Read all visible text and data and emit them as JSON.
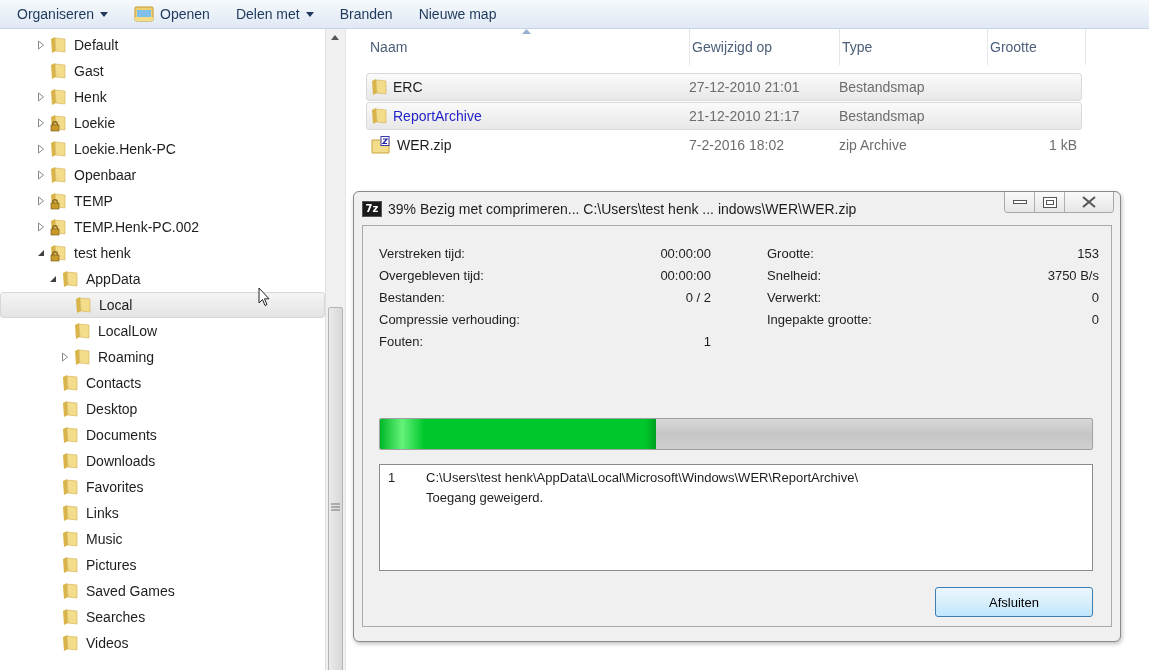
{
  "toolbar": {
    "items": [
      {
        "label": "Organiseren",
        "kind": "menu"
      },
      {
        "label": "Openen",
        "kind": "open"
      },
      {
        "label": "Delen met",
        "kind": "menu"
      },
      {
        "label": "Branden",
        "kind": "plain"
      },
      {
        "label": "Nieuwe map",
        "kind": "plain"
      }
    ]
  },
  "tree": {
    "items": [
      {
        "label": "Default",
        "expanded": false,
        "locked": false,
        "selected": false
      },
      {
        "label": "Gast",
        "locked": false,
        "selected": false
      },
      {
        "label": "Henk",
        "expanded": false,
        "locked": false,
        "selected": false
      },
      {
        "label": "Loekie",
        "expanded": false,
        "locked": true,
        "selected": false
      },
      {
        "label": "Loekie.Henk-PC",
        "expanded": false,
        "locked": false,
        "selected": false
      },
      {
        "label": "Openbaar",
        "expanded": false,
        "locked": false,
        "selected": false
      },
      {
        "label": "TEMP",
        "expanded": false,
        "locked": true,
        "selected": false
      },
      {
        "label": "TEMP.Henk-PC.002",
        "expanded": false,
        "locked": true,
        "selected": false
      },
      {
        "label": "test henk",
        "expanded": true,
        "locked": true,
        "selected": false,
        "children": [
          {
            "label": "AppData",
            "expanded": true,
            "locked": false,
            "selected": false,
            "children": [
              {
                "label": "Local",
                "locked": false,
                "selected": true
              },
              {
                "label": "LocalLow",
                "locked": false,
                "selected": false
              },
              {
                "label": "Roaming",
                "expanded": false,
                "locked": false,
                "selected": false
              }
            ]
          },
          {
            "label": "Contacts",
            "locked": false,
            "selected": false
          },
          {
            "label": "Desktop",
            "locked": false,
            "selected": false
          },
          {
            "label": "Documents",
            "locked": false,
            "selected": false
          },
          {
            "label": "Downloads",
            "locked": false,
            "selected": false
          },
          {
            "label": "Favorites",
            "locked": false,
            "selected": false
          },
          {
            "label": "Links",
            "locked": false,
            "selected": false
          },
          {
            "label": "Music",
            "locked": false,
            "selected": false
          },
          {
            "label": "Pictures",
            "locked": false,
            "selected": false
          },
          {
            "label": "Saved Games",
            "locked": false,
            "selected": false
          },
          {
            "label": "Searches",
            "locked": false,
            "selected": false
          },
          {
            "label": "Videos",
            "locked": false,
            "selected": false
          }
        ]
      }
    ]
  },
  "file_list": {
    "columns": [
      {
        "label": "Naam",
        "sorted": true
      },
      {
        "label": "Gewijzigd op",
        "sorted": false
      },
      {
        "label": "Type",
        "sorted": false
      },
      {
        "label": "Grootte",
        "sorted": false
      }
    ],
    "rows": [
      {
        "kind": "folder",
        "name": "ERC",
        "modified": "27-12-2010 21:01",
        "type": "Bestandsmap",
        "highlighted": true,
        "hot": false
      },
      {
        "kind": "folder",
        "name": "ReportArchive",
        "modified": "21-12-2010 21:17",
        "type": "Bestandsmap",
        "highlighted": true,
        "hot": true
      },
      {
        "kind": "zip",
        "name": "WER.zip",
        "modified": "7-2-2016 18:02",
        "type": "zip Archive",
        "size": "1 kB",
        "highlighted": false,
        "hot": false
      }
    ]
  },
  "dialog": {
    "title": "39% Bezig met comprimeren... C:\\Users\\test henk ... indows\\WER\\WER.zip",
    "app_icon": "7z",
    "stats_left": [
      {
        "label": "Verstreken tijd:",
        "value": "00:00:00"
      },
      {
        "label": "Overgebleven tijd:",
        "value": "00:00:00"
      },
      {
        "label": "Bestanden:",
        "value": "0 / 2"
      },
      {
        "label": "Compressie verhouding:"
      },
      {
        "label": "Fouten:",
        "value": "1"
      }
    ],
    "stats_right": [
      {
        "label": "Grootte:",
        "value": "153"
      },
      {
        "label": "Snelheid:",
        "value": "3750 B/s"
      },
      {
        "label": "Verwerkt:",
        "value": "0"
      },
      {
        "label": "Ingepakte grootte:",
        "value": "0"
      }
    ],
    "progress": {
      "level": 0.387
    },
    "log": [
      {
        "number": "1",
        "path": "C:\\Users\\test henk\\AppData\\Local\\Microsoft\\Windows\\WER\\ReportArchive\\",
        "message": "Toegang geweigerd."
      }
    ],
    "button": "Afsluiten"
  }
}
